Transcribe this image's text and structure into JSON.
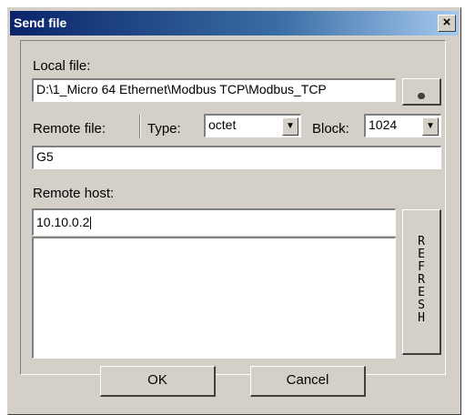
{
  "window": {
    "title": "Send file",
    "close_symbol": "×"
  },
  "local_file": {
    "label": "Local file:",
    "value": "D:\\1_Micro 64 Ethernet\\Modbus TCP\\Modbus_TCP",
    "browse_icon": "browse-icon"
  },
  "remote_file": {
    "label": "Remote file:",
    "value": "G5",
    "type_label": "Type:",
    "type_value": "octet",
    "block_label": "Block:",
    "block_value": "1024"
  },
  "remote_host": {
    "label": "Remote host:",
    "value": "10.10.0.2",
    "refresh_letters": "REFRESH"
  },
  "buttons": {
    "ok": "OK",
    "cancel": "Cancel"
  }
}
